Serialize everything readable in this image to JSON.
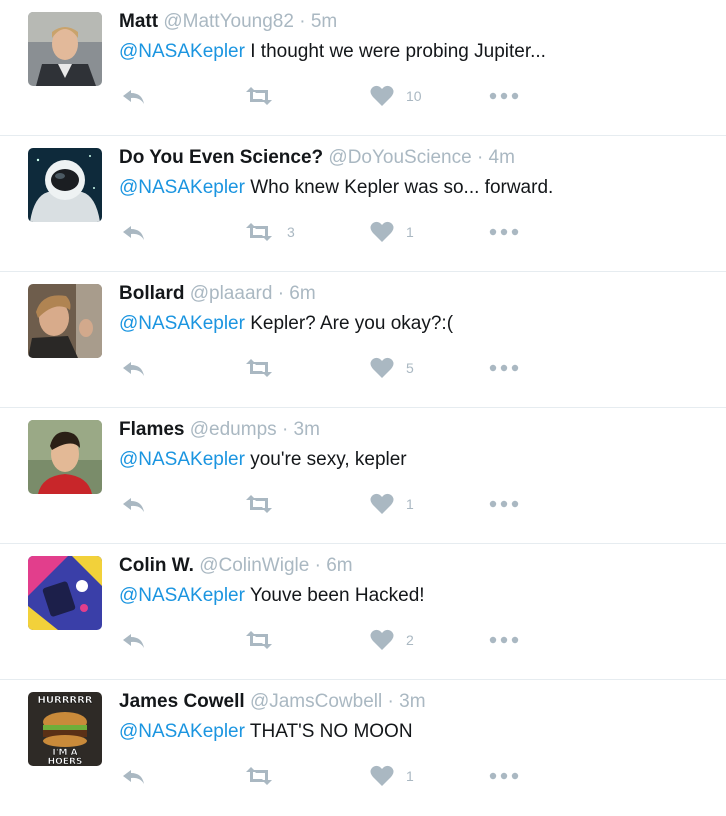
{
  "colors": {
    "mention": "#1b95e0",
    "icon": "#aab8c2",
    "name": "#14171a",
    "divider": "#e6ecf0"
  },
  "tweets": [
    {
      "name": "Matt",
      "handle": "@MattYoung82",
      "sep": "·",
      "time": "5m",
      "mention": "@NASAKepler",
      "text": " I thought we were probing Jupiter...",
      "retweets": "",
      "likes": "10",
      "avatar": "man-in-suit-photo"
    },
    {
      "name": "Do You Even Science?",
      "handle": "@DoYouScience",
      "sep": "·",
      "time": "4m",
      "mention": "@NASAKepler",
      "text": " Who knew Kepler was so... forward.",
      "retweets": "3",
      "likes": "1",
      "avatar": "astronaut-photo"
    },
    {
      "name": "Bollard",
      "handle": "@plaaard",
      "sep": "·",
      "time": "6m",
      "mention": "@NASAKepler",
      "text": " Kepler? Are you okay?:(",
      "retweets": "",
      "likes": "5",
      "avatar": "selfie-photo"
    },
    {
      "name": "Flames",
      "handle": "@edumps",
      "sep": "·",
      "time": "3m",
      "mention": "@NASAKepler",
      "text": " you're sexy, kepler",
      "retweets": "",
      "likes": "1",
      "avatar": "young-man-photo"
    },
    {
      "name": "Colin W.",
      "handle": "@ColinWigle",
      "sep": "·",
      "time": "6m",
      "mention": "@NASAKepler",
      "text": " Youve been Hacked!",
      "retweets": "",
      "likes": "2",
      "avatar": "pop-art-illustration"
    },
    {
      "name": "James Cowell",
      "handle": "@JamsCowbell",
      "sep": "·",
      "time": "3m",
      "mention": "@NASAKepler",
      "text": " THAT'S NO MOON",
      "retweets": "",
      "likes": "1",
      "avatar": "burger-meme-image",
      "avatar_text": [
        "HURRRRR",
        "I'M A",
        "HOERS"
      ]
    }
  ]
}
